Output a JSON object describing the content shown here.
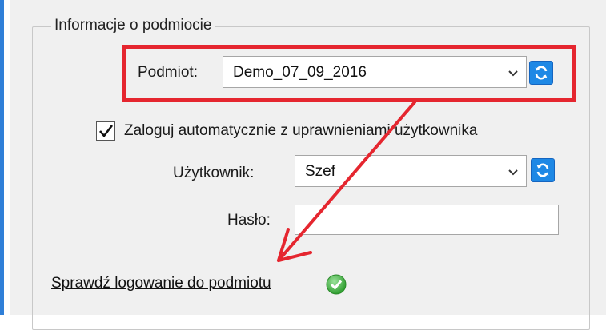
{
  "group": {
    "title": "Informacje o podmiocie"
  },
  "entity": {
    "label": "Podmiot:",
    "value": "Demo_07_09_2016"
  },
  "autologin": {
    "checked": true,
    "label": "Zaloguj automatycznie z uprawnieniami użytkownika"
  },
  "user": {
    "label": "Użytkownik:",
    "value": "Szef"
  },
  "password": {
    "label": "Hasło:",
    "value": ""
  },
  "check_login": {
    "label": "Sprawdź logowanie do podmiotu"
  },
  "icons": {
    "refresh": "refresh-icon",
    "dropdown": "chevron-down-icon",
    "check": "check-icon",
    "success": "success-check-icon"
  },
  "colors": {
    "accent": "#1e88e5",
    "annotation": "#e5262f",
    "success": "#3fae3f"
  }
}
